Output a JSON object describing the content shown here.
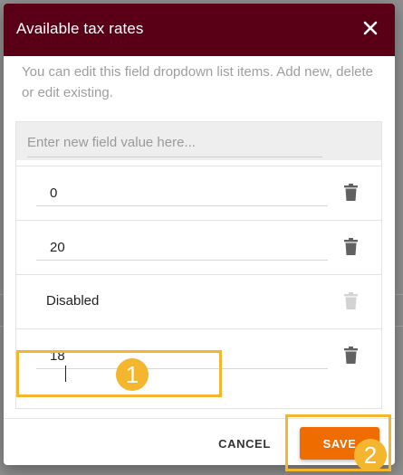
{
  "dialog": {
    "title": "Available tax rates",
    "description": "You can edit this field dropdown list items. Add new, delete or edit existing.",
    "new_value_placeholder": "Enter new field value here...",
    "items": [
      {
        "value": "0",
        "editable": true,
        "delete_enabled": true
      },
      {
        "value": "20",
        "editable": true,
        "delete_enabled": true
      },
      {
        "value": "Disabled",
        "editable": false,
        "delete_enabled": false
      },
      {
        "value": "18",
        "editable": true,
        "delete_enabled": true
      }
    ],
    "cancel_label": "CANCEL",
    "save_label": "SAVE"
  },
  "annotations": {
    "step_1": "1",
    "step_2": "2",
    "highlight_color": "#f4b52f"
  },
  "colors": {
    "header_bg": "#5a0016",
    "save_bg": "#ef6c00",
    "icon_active": "#616161",
    "icon_disabled": "#d3d3d3"
  },
  "icons": {
    "close": "close-icon",
    "delete": "trash-icon"
  }
}
